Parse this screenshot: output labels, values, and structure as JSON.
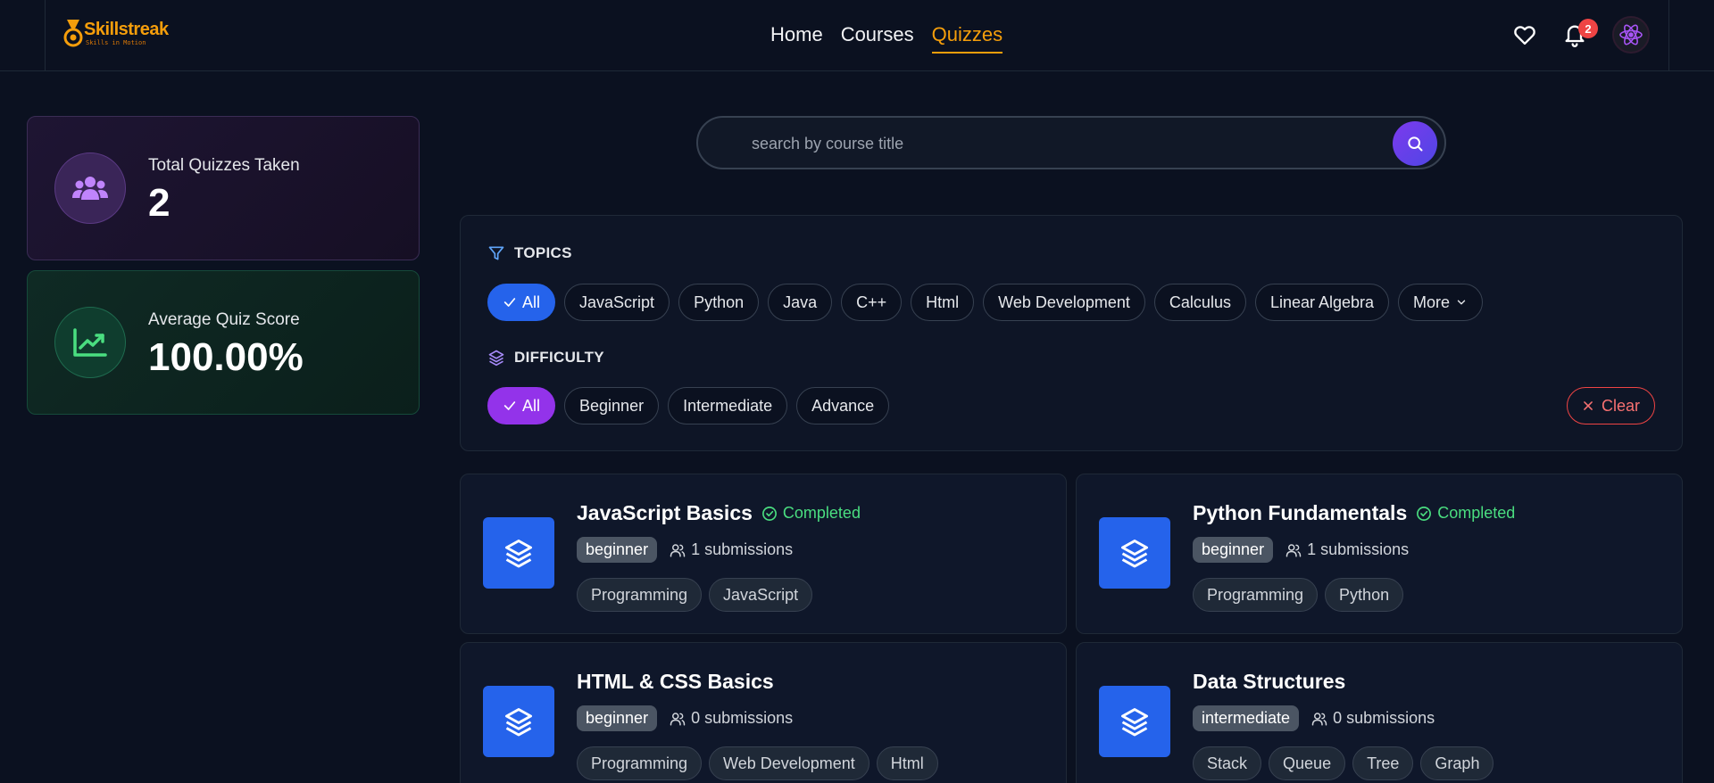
{
  "brand": {
    "name": "Skillstreak",
    "tagline": "Skills in Motion",
    "color": "#f59e0b"
  },
  "nav": [
    {
      "label": "Home",
      "active": false
    },
    {
      "label": "Courses",
      "active": false
    },
    {
      "label": "Quizzes",
      "active": true
    }
  ],
  "header": {
    "notification_count": "2",
    "icons": [
      "heart-icon",
      "bell-icon",
      "avatar"
    ]
  },
  "stats": {
    "total_label": "Total Quizzes Taken",
    "total_value": "2",
    "avg_label": "Average Quiz Score",
    "avg_value": "100.00%"
  },
  "search": {
    "placeholder": "search by course title"
  },
  "filters": {
    "topics_title": "TOPICS",
    "topics": [
      "All",
      "JavaScript",
      "Python",
      "Java",
      "C++",
      "Html",
      "Web Development",
      "Calculus",
      "Linear Algebra",
      "More"
    ],
    "topics_selected": "All",
    "difficulty_title": "DIFFICULTY",
    "difficulties": [
      "All",
      "Beginner",
      "Intermediate",
      "Advance"
    ],
    "difficulty_selected": "All",
    "clear_label": "Clear"
  },
  "quizzes": [
    {
      "title": "JavaScript Basics",
      "status": "Completed",
      "level": "beginner",
      "submissions": "1 submissions",
      "tags": [
        "Programming",
        "JavaScript"
      ]
    },
    {
      "title": "Python Fundamentals",
      "status": "Completed",
      "level": "beginner",
      "submissions": "1 submissions",
      "tags": [
        "Programming",
        "Python"
      ]
    },
    {
      "title": "HTML & CSS Basics",
      "status": "",
      "level": "beginner",
      "submissions": "0 submissions",
      "tags": [
        "Programming",
        "Web Development",
        "Html"
      ]
    },
    {
      "title": "Data Structures",
      "status": "",
      "level": "intermediate",
      "submissions": "0 submissions",
      "tags": [
        "Stack",
        "Queue",
        "Tree",
        "Graph"
      ]
    }
  ]
}
